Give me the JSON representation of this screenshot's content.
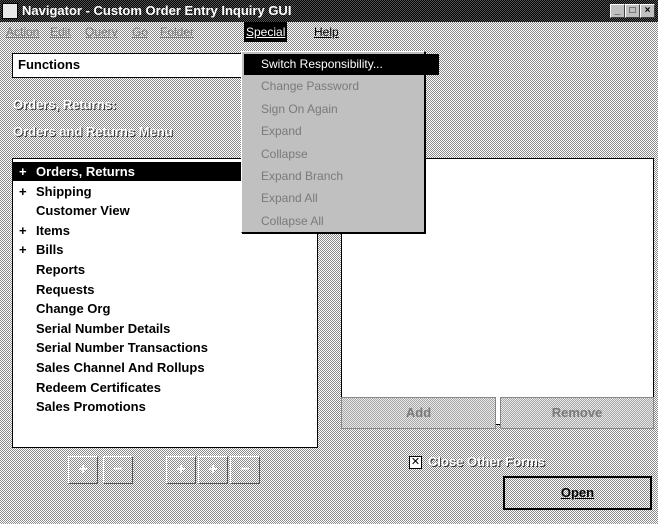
{
  "window": {
    "title": "Navigator - Custom Order Entry Inquiry GUI"
  },
  "menubar": {
    "items": [
      {
        "label": "Action",
        "enabled": false
      },
      {
        "label": "Edit",
        "enabled": false
      },
      {
        "label": "Query",
        "enabled": false
      },
      {
        "label": "Go",
        "enabled": false
      },
      {
        "label": "Folder",
        "enabled": false
      },
      {
        "label": "Special",
        "enabled": true,
        "active": true
      },
      {
        "label": "Help",
        "enabled": true
      }
    ]
  },
  "special_menu": {
    "items": [
      {
        "label": "Switch Responsibility...",
        "enabled": true,
        "selected": true
      },
      {
        "label": "Change Password",
        "enabled": false
      },
      {
        "label": "Sign On Again",
        "enabled": false
      },
      {
        "label": "Expand",
        "enabled": false
      },
      {
        "label": "Collapse",
        "enabled": false
      },
      {
        "label": "Expand Branch",
        "enabled": false
      },
      {
        "label": "Expand All",
        "enabled": false
      },
      {
        "label": "Collapse All",
        "enabled": false
      }
    ]
  },
  "left_panel": {
    "functions_label": "Functions",
    "context": "Orders, Returns:",
    "menu_name": "Orders and Returns Menu",
    "tree": [
      {
        "sign": "+",
        "label": "Orders, Returns",
        "selected": true
      },
      {
        "sign": "+",
        "label": "Shipping"
      },
      {
        "sign": "",
        "label": "Customer View"
      },
      {
        "sign": "+",
        "label": "Items"
      },
      {
        "sign": "+",
        "label": "Bills"
      },
      {
        "sign": "",
        "label": "Reports"
      },
      {
        "sign": "",
        "label": "Requests"
      },
      {
        "sign": "",
        "label": "Change Org"
      },
      {
        "sign": "",
        "label": "Serial Number Details"
      },
      {
        "sign": "",
        "label": "Serial Number Transactions"
      },
      {
        "sign": "",
        "label": "Sales Channel And Rollups"
      },
      {
        "sign": "",
        "label": "Redeem Certificates"
      },
      {
        "sign": "",
        "label": "Sales Promotions"
      }
    ],
    "toolbar": [
      {
        "icon": "expand-icon",
        "glyph": "+"
      },
      {
        "icon": "collapse-icon",
        "glyph": "−"
      },
      {
        "icon": "expand-branch-icon",
        "glyph": "+"
      },
      {
        "icon": "expand-all-icon",
        "glyph": "+"
      },
      {
        "icon": "collapse-all-icon",
        "glyph": "−"
      }
    ]
  },
  "right_panel": {
    "add_label": "Add",
    "remove_label": "Remove",
    "close_other_forms": {
      "label": "Close Other Forms",
      "checked": true,
      "check_glyph": "✕"
    },
    "open_label": "Open"
  }
}
